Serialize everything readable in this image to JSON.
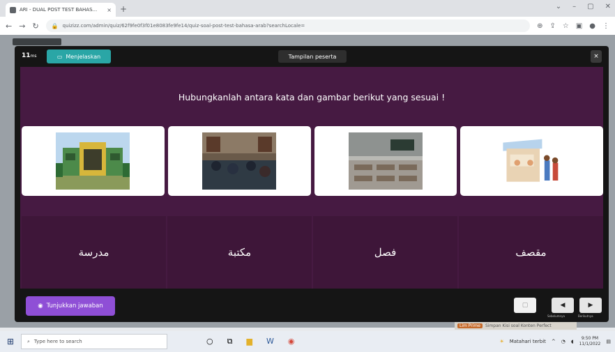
{
  "browser": {
    "tab_title": "ARI - DUAL POST TEST BAHAS...",
    "tab_close": "×",
    "new_tab": "+",
    "window_controls": [
      "⌄",
      "–",
      "▢",
      "✕"
    ],
    "url": "quizizz.com/admin/quiz/62f9fe0f3f01e8083fe9fe14/quiz-soal-post-test-bahasa-arab?searchLocale="
  },
  "modal": {
    "question_number": "11",
    "question_suffix": "ms",
    "describe_button": "Menjelaskan",
    "preview_label": "Tampilan peserta",
    "close": "×",
    "question_text": "Hubungkanlah antara kata dan gambar berikut yang sesuai !",
    "images": [
      {
        "subject": "school building"
      },
      {
        "subject": "library"
      },
      {
        "subject": "classroom"
      },
      {
        "subject": "canteen"
      }
    ],
    "answers": [
      "مدرسة",
      "مكتبة",
      "فصل",
      "مقصف"
    ],
    "show_answer_button": "Tunjukkan jawaban",
    "nav_prev": "◀",
    "nav_next": "▶",
    "nav_prev_label": "Sebelumnya",
    "nav_next_label": "Berikutnya"
  },
  "hint_bar": {
    "button": "Lim Prime",
    "text": "Simpan Kisi soal Konten Perfect"
  },
  "taskbar": {
    "search_placeholder": "Type here to search",
    "weather": "Matahari terbit",
    "time": "9:50 PM",
    "date": "11/1/2022"
  }
}
